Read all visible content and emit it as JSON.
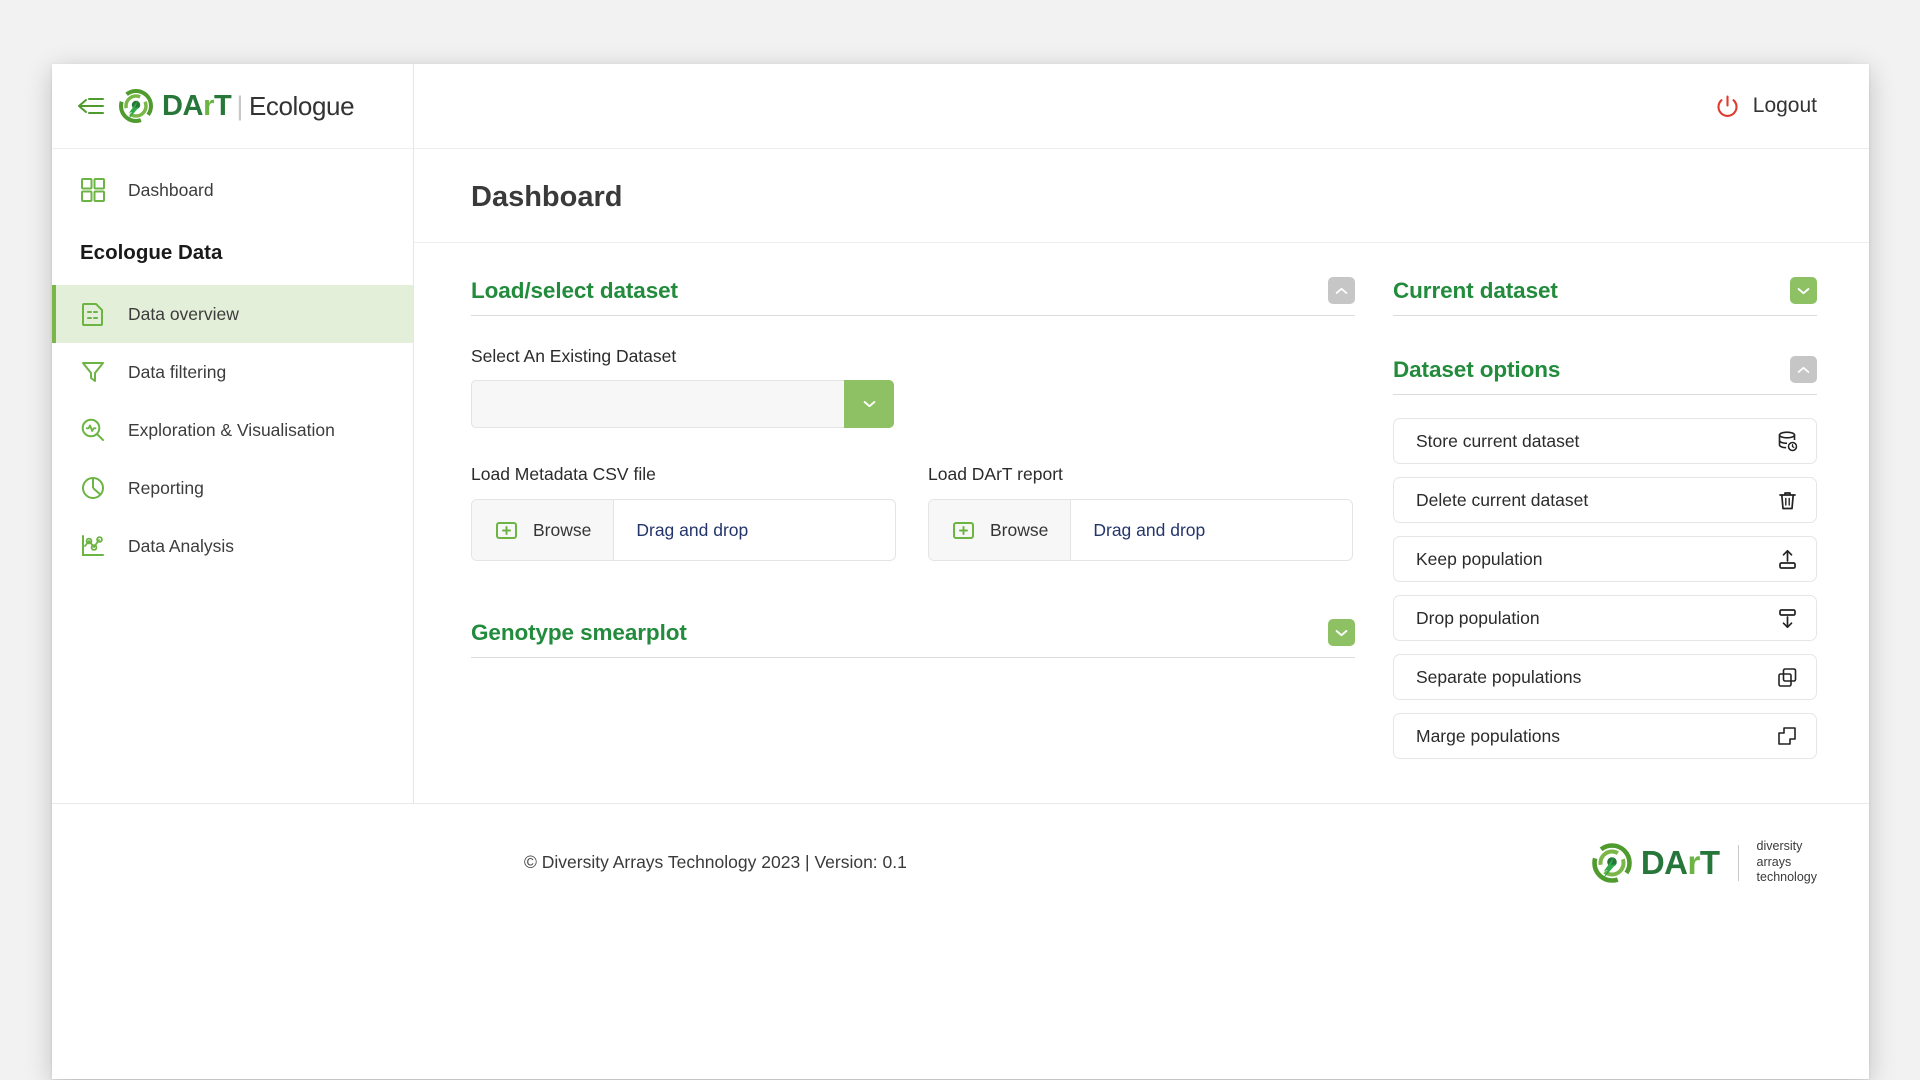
{
  "window": {
    "brand": {
      "name_dar": "DA",
      "name_r": "r",
      "name_t": "T",
      "separator": "|",
      "product": "Ecologue"
    },
    "logout": {
      "label": "Logout",
      "icon": "power-icon",
      "color": "#e03a2f"
    }
  },
  "sidebar": {
    "section_label": "Ecologue Data",
    "top_items": [
      {
        "label": "Dashboard",
        "icon": "grid-icon"
      }
    ],
    "items": [
      {
        "label": "Data overview",
        "icon": "document-lines-icon",
        "active": true
      },
      {
        "label": "Data filtering",
        "icon": "funnel-icon",
        "active": false
      },
      {
        "label": "Exploration & Visualisation",
        "icon": "search-pulse-icon",
        "active": false
      },
      {
        "label": "Reporting",
        "icon": "pie-chart-icon",
        "active": false
      },
      {
        "label": "Data Analysis",
        "icon": "scatter-chart-icon",
        "active": false
      }
    ]
  },
  "page": {
    "title": "Dashboard"
  },
  "load_dataset_card": {
    "title": "Load/select dataset",
    "toggle_icon": "chevron-up-icon",
    "toggle_state": "expanded",
    "select_label": "Select An Existing Dataset",
    "select_value": "",
    "select_placeholder": "",
    "select_button_icon": "chevron-down-icon",
    "uploads": [
      {
        "label": "Load Metadata CSV file",
        "browse_label": "Browse",
        "browse_icon": "folder-plus-icon",
        "drop_label": "Drag and drop"
      },
      {
        "label": "Load DArT report",
        "browse_label": "Browse",
        "browse_icon": "folder-plus-icon",
        "drop_label": "Drag and drop"
      }
    ]
  },
  "smearplot_card": {
    "title": "Genotype smearplot",
    "toggle_icon": "chevron-down-icon",
    "toggle_state": "collapsed"
  },
  "current_dataset_card": {
    "title": "Current dataset",
    "toggle_icon": "chevron-down-icon",
    "toggle_state": "collapsed"
  },
  "dataset_options_card": {
    "title": "Dataset options",
    "toggle_icon": "chevron-up-icon",
    "toggle_state": "expanded",
    "options": [
      {
        "label": "Store current dataset",
        "icon": "database-refresh-icon"
      },
      {
        "label": "Delete current dataset",
        "icon": "trash-icon"
      },
      {
        "label": "Keep population",
        "icon": "upload-icon"
      },
      {
        "label": "Drop population",
        "icon": "download-icon"
      },
      {
        "label": "Separate populations",
        "icon": "split-squares-icon"
      },
      {
        "label": "Marge populations",
        "icon": "copy-squares-icon"
      }
    ]
  },
  "footer": {
    "text": "© Diversity Arrays Technology 2023 | Version: 0.1",
    "logo_tagline_1": "diversity",
    "logo_tagline_2": "arrays",
    "logo_tagline_3": "technology"
  },
  "colors": {
    "brand_dark_green": "#27763a",
    "brand_light_green": "#6cb443",
    "accent_green": "#8dc163",
    "active_bg": "#e4efd9",
    "logout_red": "#e03a2f",
    "link_navy": "#24356b"
  }
}
